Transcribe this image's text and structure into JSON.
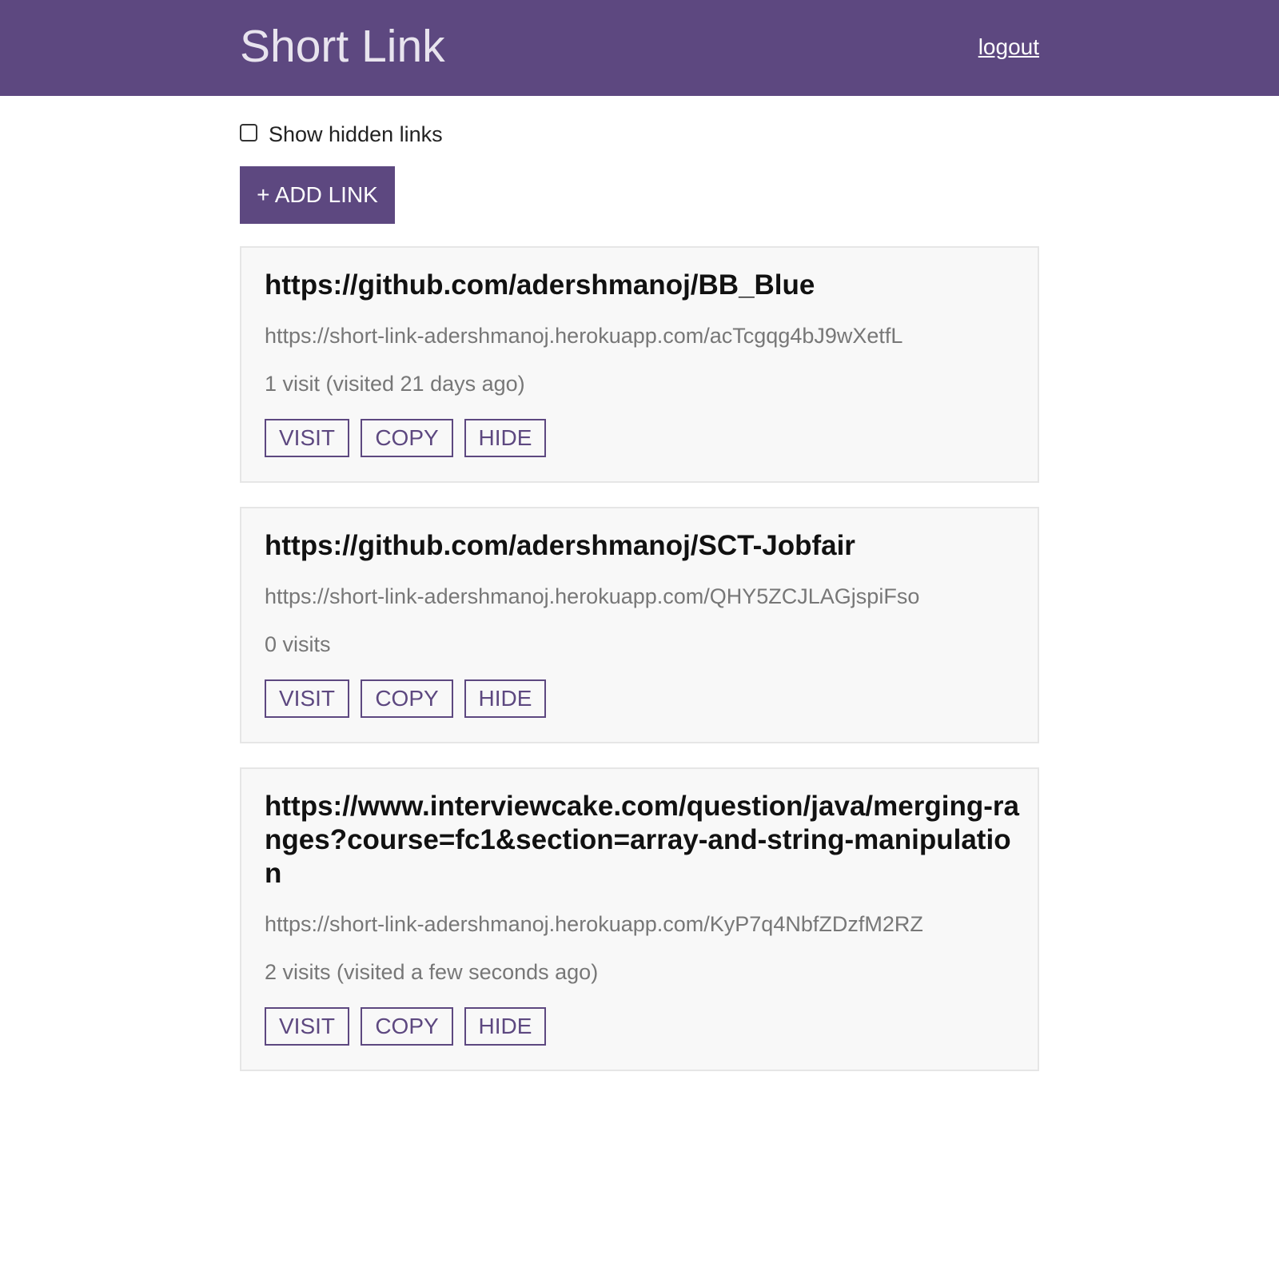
{
  "header": {
    "title": "Short Link",
    "logout_label": "logout"
  },
  "controls": {
    "show_hidden_label": "Show hidden links",
    "show_hidden_checked": false,
    "add_link_label": "+ ADD LINK"
  },
  "links": [
    {
      "url": "https://github.com/adershmanoj/BB_Blue",
      "short_url": "https://short-link-adershmanoj.herokuapp.com/acTcgqg4bJ9wXetfL",
      "visits_text": "1 visit (visited 21 days ago)",
      "visit_label": "VISIT",
      "copy_label": "COPY",
      "hide_label": "HIDE"
    },
    {
      "url": "https://github.com/adershmanoj/SCT-Jobfair",
      "short_url": "https://short-link-adershmanoj.herokuapp.com/QHY5ZCJLAGjspiFso",
      "visits_text": "0 visits",
      "visit_label": "VISIT",
      "copy_label": "COPY",
      "hide_label": "HIDE"
    },
    {
      "url": "https://www.interviewcake.com/question/java/merging-ranges?course=fc1&section=array-and-string-manipulation",
      "short_url": "https://short-link-adershmanoj.herokuapp.com/KyP7q4NbfZDzfM2RZ",
      "visits_text": "2 visits (visited a few seconds ago)",
      "visit_label": "VISIT",
      "copy_label": "COPY",
      "hide_label": "HIDE"
    }
  ],
  "colors": {
    "brand": "#5d4880",
    "card_background": "#f8f8f8",
    "muted_text": "#777777"
  }
}
